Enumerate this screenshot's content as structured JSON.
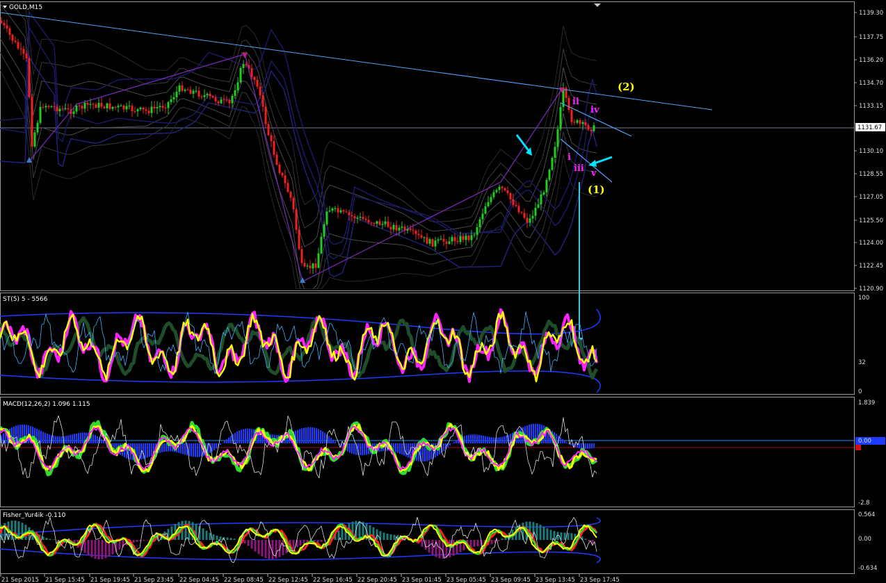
{
  "window": {
    "symbol_title": "GOLD,M15",
    "current_price_badge": "1131.67"
  },
  "colors": {
    "background": "#000000",
    "bull_candle": "#22cc22",
    "bear_candle": "#ee2222",
    "trendline": "#4fa3ff",
    "stoch_main": "#ffff00",
    "macd_hist": "#1e3cff",
    "wave_count": "#ff22ff",
    "wave_degree": "#ffff00",
    "arrow": "#00e5ff"
  },
  "panels": {
    "price": {
      "y_ticks": [
        "1139.30",
        "1137.75",
        "1136.20",
        "1134.70",
        "1133.15",
        "1131.67",
        "1130.10",
        "1128.55",
        "1127.05",
        "1125.50",
        "1124.00",
        "1122.45",
        "1120.90"
      ],
      "wave_labels": {
        "ii": "ii",
        "iv": "iv",
        "i": "i",
        "iii": "iii",
        "v": "v",
        "one": "(1)",
        "two": "(2)"
      }
    },
    "stoch": {
      "title": "ST(5) 5 - 5566",
      "y_ticks": [
        "100",
        "32",
        "0"
      ]
    },
    "macd": {
      "title": "MACD(12,26,2) 1.096 1.115",
      "y_ticks": [
        "1.839",
        "0.00",
        "-2.8"
      ]
    },
    "fisher": {
      "title": "Fisher_Yur4ik -0.110",
      "y_ticks": [
        "0.564",
        "0.00",
        "-0.634"
      ]
    }
  },
  "x_axis": {
    "labels": [
      "21 Sep 2015",
      "21 Sep 15:45",
      "21 Sep 19:45",
      "21 Sep 23:45",
      "22 Sep 04:45",
      "22 Sep 08:45",
      "22 Sep 12:45",
      "22 Sep 16:45",
      "22 Sep 20:45",
      "23 Sep 01:45",
      "23 Sep 05:45",
      "23 Sep 09:45",
      "23 Sep 13:45",
      "23 Sep 17:45"
    ]
  }
}
